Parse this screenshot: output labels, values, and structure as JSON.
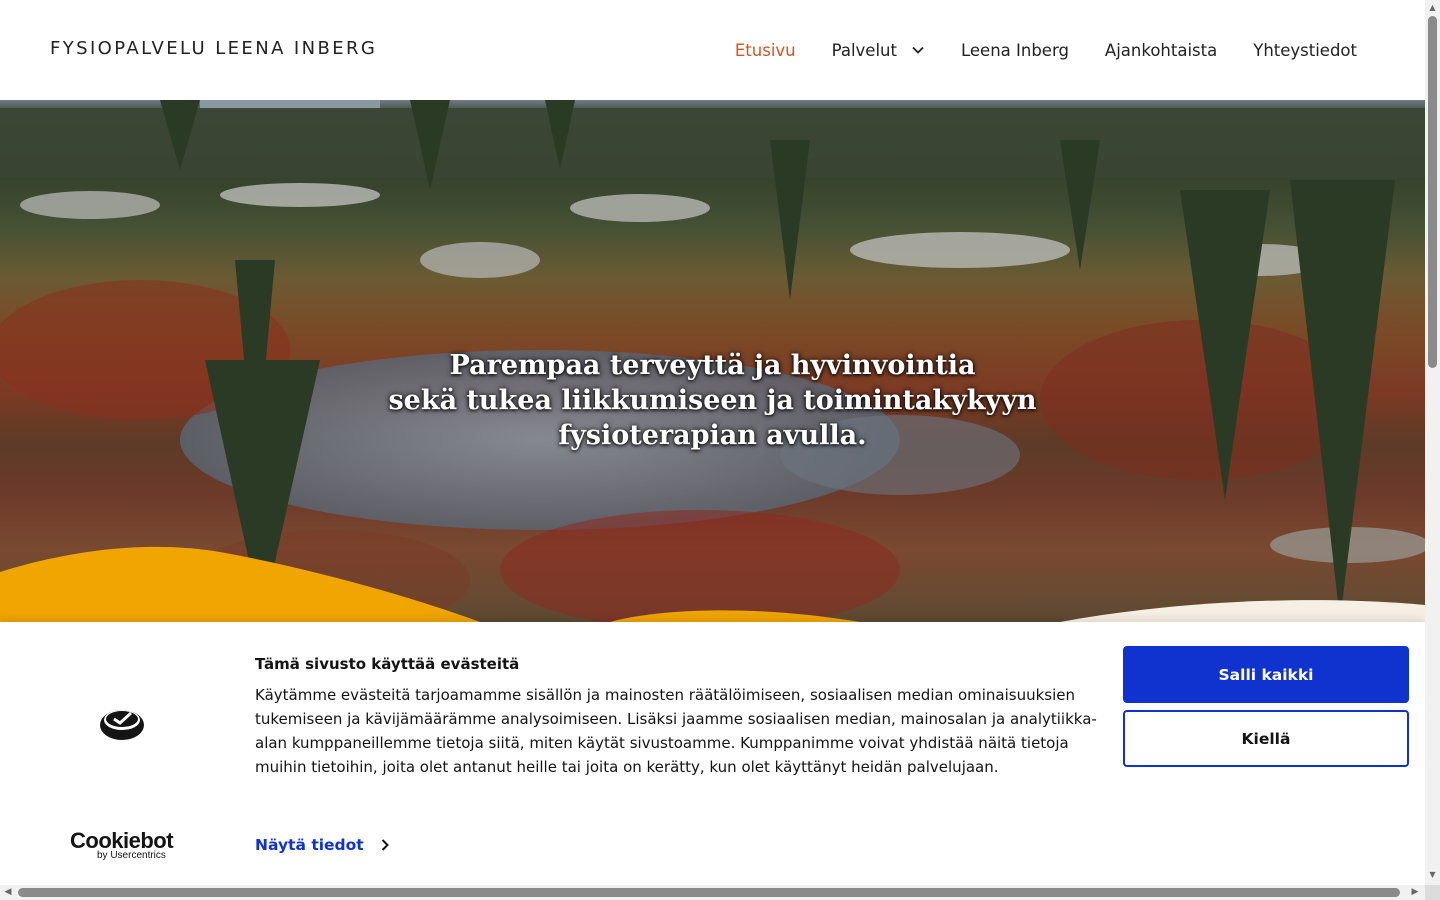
{
  "header": {
    "site_title": "FYSIOPALVELU LEENA INBERG",
    "nav": [
      {
        "label": "Etusivu",
        "active": true
      },
      {
        "label": "Palvelut",
        "has_dropdown": true
      },
      {
        "label": "Leena Inberg"
      },
      {
        "label": "Ajankohtaista"
      },
      {
        "label": "Yhteystiedot"
      }
    ]
  },
  "hero": {
    "lines": [
      "Parempaa terveyttä ja hyvinvointia",
      "sekä tukea liikkumiseen ja toimintakykyyn",
      "fysioterapian avulla."
    ]
  },
  "cookie_banner": {
    "title": "Tämä sivusto käyttää evästeitä",
    "body": "Käytämme evästeitä tarjoamamme sisällön ja mainosten räätälöimiseen, sosiaalisen median ominaisuuksien tukemiseen ja kävijämäärämme analysoimiseen. Lisäksi jaamme sosiaalisen median, mainosalan ja analytiikka-alan kumppaneillemme tietoja siitä, miten käytät sivustoamme. Kumppanimme voivat yhdistää näitä tietoja muihin tietoihin, joita olet antanut heille tai joita on kerätty, kun olet käyttänyt heidän palvelujaan.",
    "details_link": "Näytä tiedot",
    "allow_all": "Salli kaikki",
    "deny": "Kiellä",
    "brand": "Cookiebot",
    "brand_sub": "by Usercentrics"
  },
  "colors": {
    "nav_active": "#d9531e",
    "cookie_blue": "#1032cf",
    "hero_wave_yellow": "#f0a500",
    "hero_wave_cream": "#f6efe4"
  },
  "icons": {
    "dropdown": "chevron-down-icon",
    "details": "chevron-right-icon",
    "logo": "cookiebot-logo-icon"
  }
}
